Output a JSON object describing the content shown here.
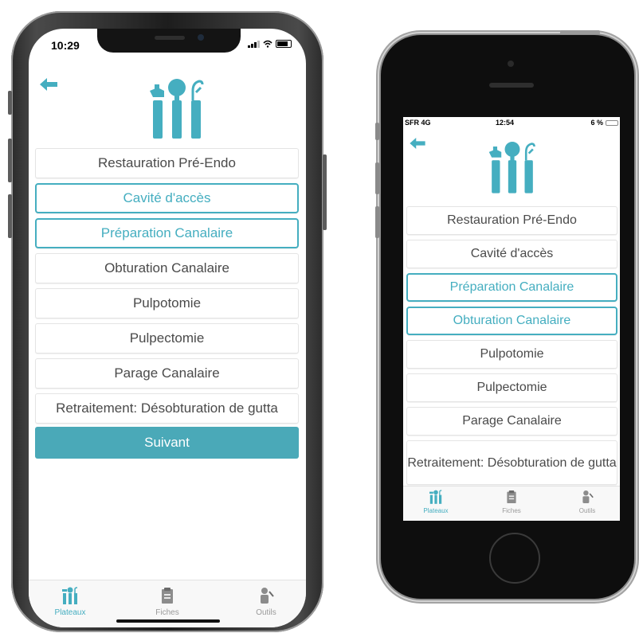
{
  "colors": {
    "accent": "#45aec0",
    "button": "#4aa9b8",
    "text": "#4a4a4a",
    "tab_inactive": "#9a9a9a"
  },
  "back_icon": "arrow-left-icon",
  "logo_icon": "dental-tools-icon",
  "phone_left": {
    "status": {
      "time": "10:29"
    },
    "items": [
      {
        "label": "Restauration Pré-Endo",
        "selected": false
      },
      {
        "label": "Cavité d'accès",
        "selected": true
      },
      {
        "label": "Préparation Canalaire",
        "selected": true
      },
      {
        "label": "Obturation Canalaire",
        "selected": false
      },
      {
        "label": "Pulpotomie",
        "selected": false
      },
      {
        "label": "Pulpectomie",
        "selected": false
      },
      {
        "label": "Parage Canalaire",
        "selected": false
      },
      {
        "label": "Retraitement: Désobturation de gutta",
        "selected": false
      }
    ],
    "next_button": "Suivant",
    "tabs": [
      {
        "label": "Plateaux",
        "icon": "plateaux-icon",
        "active": true
      },
      {
        "label": "Fiches",
        "icon": "fiches-icon",
        "active": false
      },
      {
        "label": "Outils",
        "icon": "outils-icon",
        "active": false
      }
    ]
  },
  "phone_right": {
    "status": {
      "carrier": "SFR 4G",
      "time": "12:54",
      "battery": "6 %"
    },
    "items": [
      {
        "label": "Restauration Pré-Endo",
        "selected": false
      },
      {
        "label": "Cavité d'accès",
        "selected": false
      },
      {
        "label": "Préparation Canalaire",
        "selected": true
      },
      {
        "label": "Obturation Canalaire",
        "selected": true
      },
      {
        "label": "Pulpotomie",
        "selected": false
      },
      {
        "label": "Pulpectomie",
        "selected": false
      },
      {
        "label": "Parage Canalaire",
        "selected": false
      },
      {
        "label": "Retraitement: Désobturation de gutta",
        "selected": false
      }
    ],
    "tabs": [
      {
        "label": "Plateaux",
        "icon": "plateaux-icon",
        "active": true
      },
      {
        "label": "Fiches",
        "icon": "fiches-icon",
        "active": false
      },
      {
        "label": "Outils",
        "icon": "outils-icon",
        "active": false
      }
    ]
  }
}
